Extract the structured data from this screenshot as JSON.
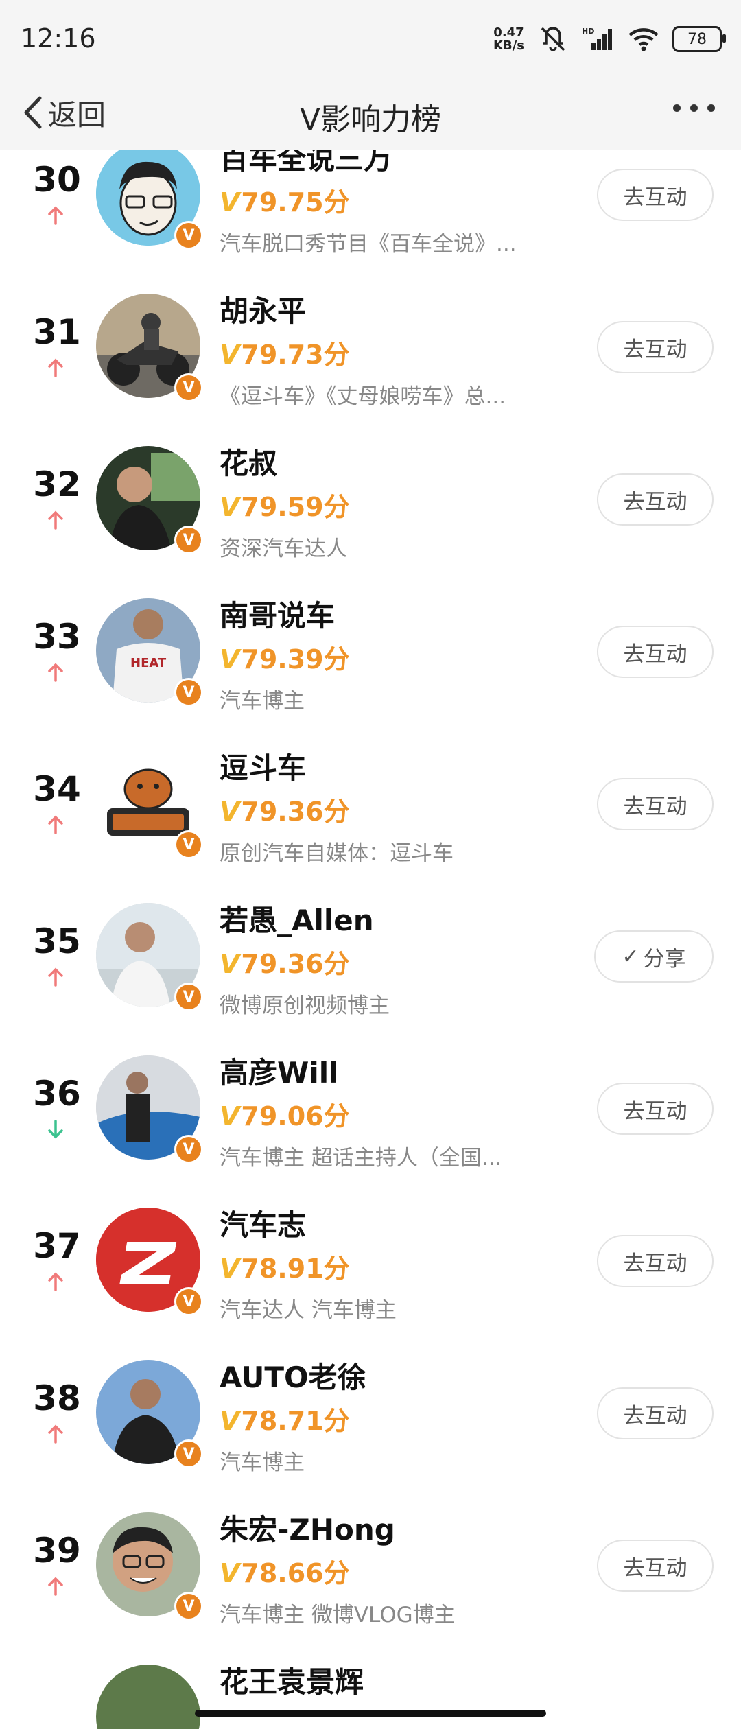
{
  "status_bar": {
    "time": "12:16",
    "speed_value": "0.47",
    "speed_unit": "KB/s",
    "battery": "78"
  },
  "nav": {
    "back_label": "返回",
    "title": "V影响力榜"
  },
  "list": [
    {
      "rank": "30",
      "trend": "up",
      "name": "百车全说三万",
      "score": "79.75分",
      "desc": "汽车脱口秀节目《百车全说》...",
      "button": "去互动"
    },
    {
      "rank": "31",
      "trend": "up",
      "name": "胡永平",
      "score": "79.73分",
      "desc": "《逗斗车》《丈母娘唠车》总...",
      "button": "去互动"
    },
    {
      "rank": "32",
      "trend": "up",
      "name": "花叔",
      "score": "79.59分",
      "desc": "资深汽车达人",
      "button": "去互动"
    },
    {
      "rank": "33",
      "trend": "up",
      "name": "南哥说车",
      "score": "79.39分",
      "desc": "汽车博主",
      "button": "去互动"
    },
    {
      "rank": "34",
      "trend": "up",
      "name": "逗斗车",
      "score": "79.36分",
      "desc": "原创汽车自媒体：逗斗车",
      "button": "去互动"
    },
    {
      "rank": "35",
      "trend": "up",
      "name": "若愚_Allen",
      "score": "79.36分",
      "desc": "微博原创视频博主",
      "button": "分享"
    },
    {
      "rank": "36",
      "trend": "down",
      "name": "高彦Will",
      "score": "79.06分",
      "desc": "汽车博主 超话主持人（全国...",
      "button": "去互动"
    },
    {
      "rank": "37",
      "trend": "up",
      "name": "汽车志",
      "score": "78.91分",
      "desc": "汽车达人 汽车博主",
      "button": "去互动"
    },
    {
      "rank": "38",
      "trend": "up",
      "name": "AUTO老徐",
      "score": "78.71分",
      "desc": "汽车博主",
      "button": "去互动"
    },
    {
      "rank": "39",
      "trend": "up",
      "name": "朱宏-ZHong",
      "score": "78.66分",
      "desc": "汽车博主 微博VLOG博主",
      "button": "去互动"
    },
    {
      "rank": "",
      "trend": "",
      "name": "花王袁景辉",
      "score": "",
      "desc": "",
      "button": ""
    }
  ],
  "colors": {
    "score": "#f09428",
    "up_arrow": "#f07a7a",
    "down_arrow": "#3cc28f",
    "verified_badge": "#e8821e"
  },
  "icons": {
    "verified": "V",
    "score_prefix": "V",
    "share_check": "✓"
  }
}
